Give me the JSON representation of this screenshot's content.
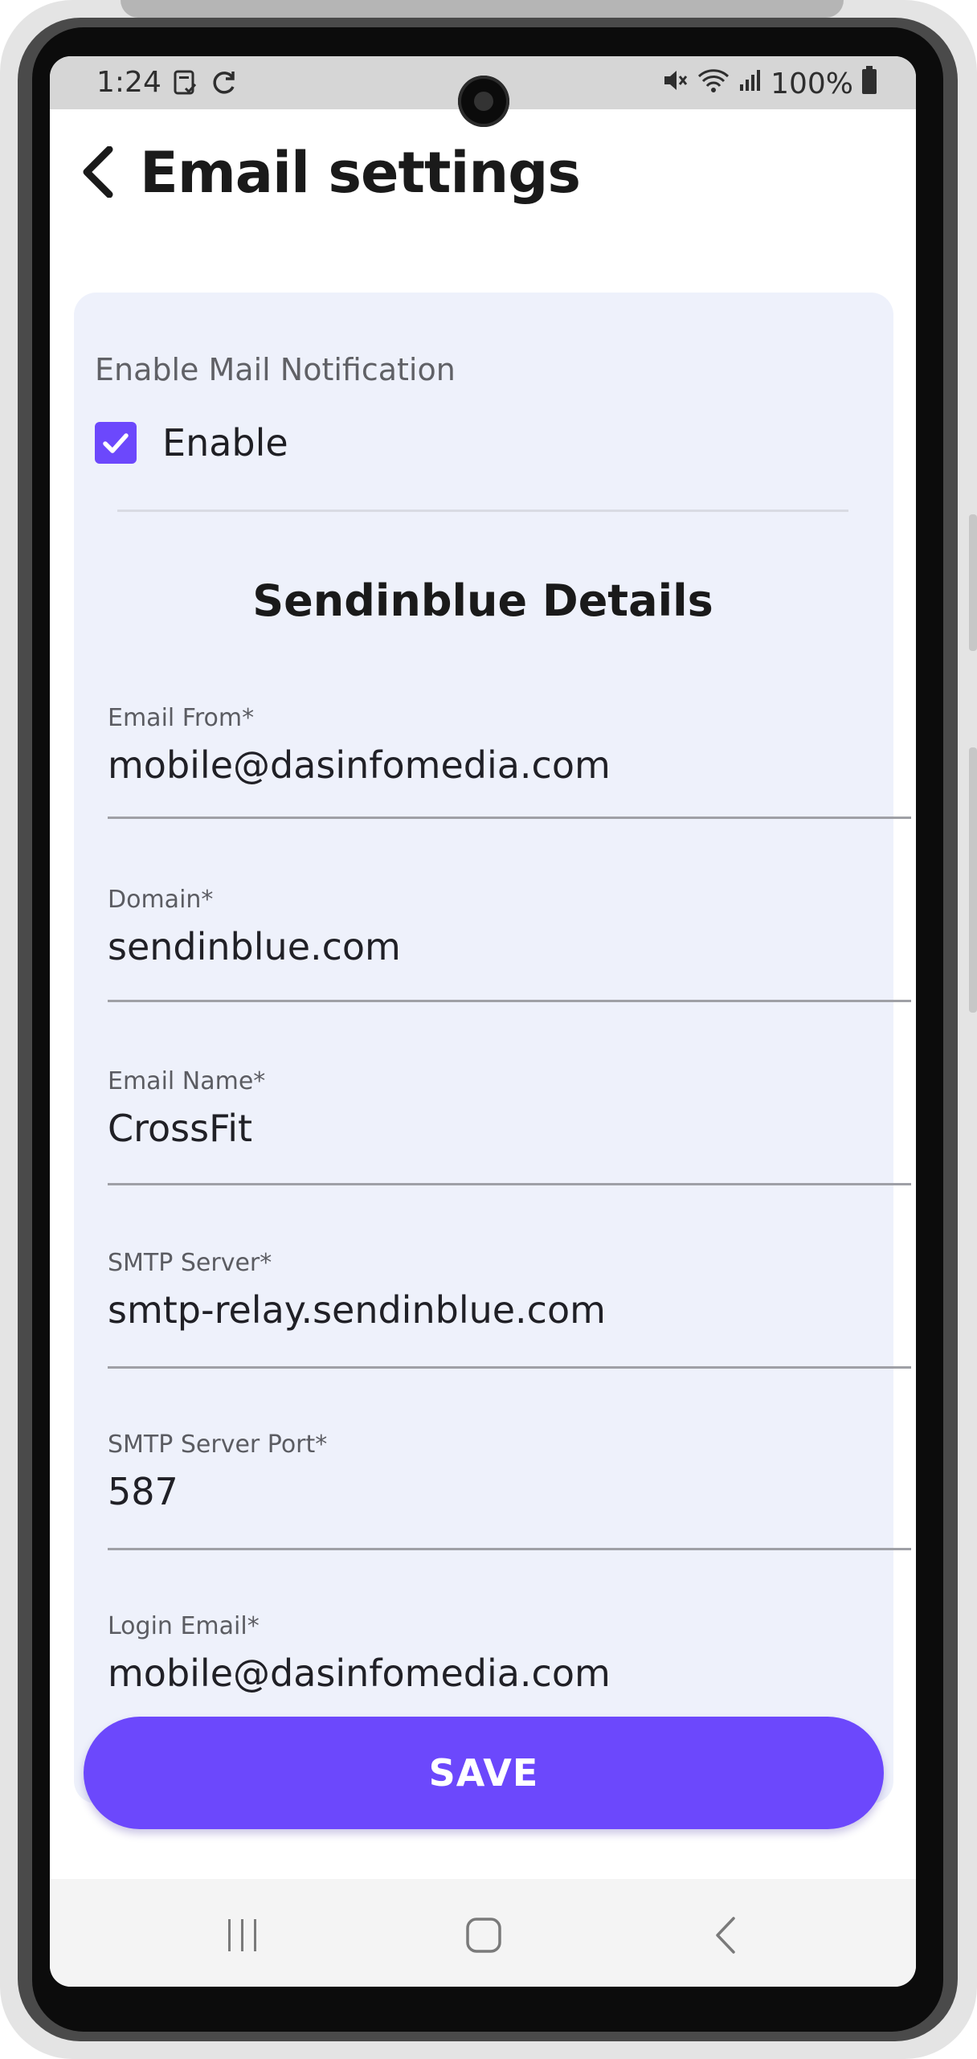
{
  "status_bar": {
    "time": "1:24",
    "battery": "100%",
    "icons": [
      "screenshot-icon",
      "sync-icon",
      "mute-icon",
      "wifi-icon",
      "signal-icon",
      "battery-icon"
    ]
  },
  "header": {
    "title": "Email settings",
    "back_icon": "chevron-left-icon"
  },
  "notification": {
    "section_label": "Enable Mail Notification",
    "checkbox_label": "Enable",
    "checked": true
  },
  "section_title": "Sendinblue Details",
  "fields": [
    {
      "label": "Email From*",
      "value": "mobile@dasinfomedia.com"
    },
    {
      "label": "Domain*",
      "value": "sendinblue.com"
    },
    {
      "label": "Email Name*",
      "value": "CrossFit"
    },
    {
      "label": "SMTP Server*",
      "value": "smtp-relay.sendinblue.com"
    },
    {
      "label": "SMTP Server Port*",
      "value": "587"
    },
    {
      "label": "Login Email*",
      "value": "mobile@dasinfomedia.com"
    }
  ],
  "save_button": {
    "label": "SAVE"
  },
  "colors": {
    "accent": "#6C48FC",
    "card_background": "#EEF1FB",
    "status_bar": "#D6D6D6"
  },
  "nav_bar": {
    "icons": [
      "recent-apps-icon",
      "home-icon",
      "back-nav-icon"
    ]
  }
}
